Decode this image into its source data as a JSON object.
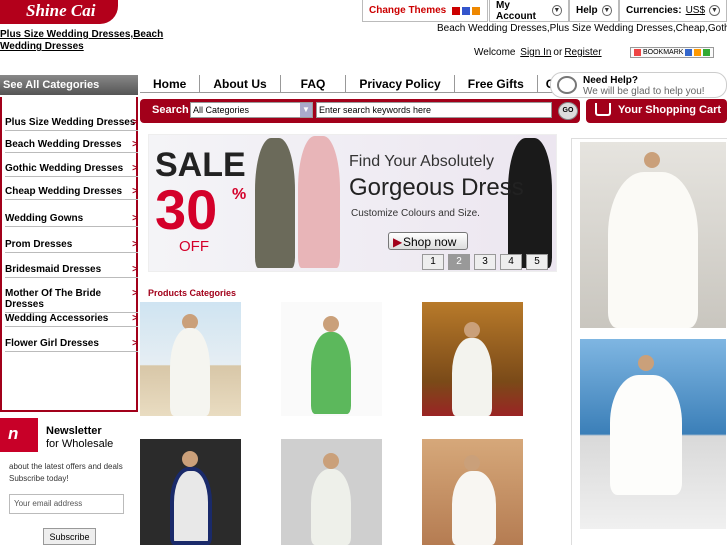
{
  "header": {
    "logo_text": "Shine Cai",
    "logo_subtitle": "Plus Size Wedding Dresses,Beach Wedding Dresses",
    "change_themes": "Change Themes",
    "theme_colors": [
      "#cc0000",
      "#3355cc",
      "#ee8800"
    ],
    "my_account": "My Account",
    "help": "Help",
    "currencies_label": "Currencies:",
    "currency_value": "US$",
    "keywords": "Beach Wedding Dresses,Plus Size Wedding Dresses,Cheap,Gothic",
    "welcome": "Welcome",
    "sign_in": "Sign In",
    "or": "or",
    "register": "Register",
    "bookmark": "BOOKMARK"
  },
  "nav": {
    "see_all": "See All Categories",
    "items": [
      "Home",
      "About Us",
      "FAQ",
      "Privacy Policy",
      "Free Gifts",
      "Contact Us"
    ],
    "need_help": "Need Help?",
    "help_sub": "We will be glad to help you!"
  },
  "search": {
    "label": "Search",
    "category": "All Categories",
    "placeholder": "Enter search keywords here",
    "go": "GO",
    "cart": "Your Shopping Cart"
  },
  "categories": [
    "Plus Size Wedding Dresses",
    "Beach Wedding Dresses",
    "Gothic Wedding Dresses",
    "Cheap Wedding Dresses",
    "Wedding Gowns",
    "Prom Dresses",
    "Bridesmaid Dresses",
    "Mother Of The Bride Dresses",
    "Wedding Accessories",
    "Flower Girl Dresses"
  ],
  "newsletter": {
    "icon_letter": "n",
    "title": "Newsletter",
    "subtitle": "for Wholesale",
    "desc": "about the latest offers and deals Subscribe today!",
    "placeholder": "Your email address",
    "button": "Subscribe"
  },
  "banner": {
    "sale": "SALE",
    "percent": "30",
    "pct_sign": "%",
    "off": "OFF",
    "find": "Find Your Absolutely",
    "gorgeous": "Gorgeous Dress",
    "customize": "Customize Colours and Size.",
    "shop_now": "Shop now",
    "pages": [
      "1",
      "2",
      "3",
      "4",
      "5"
    ],
    "active_page": "2"
  },
  "products": {
    "title": "Products Categories"
  }
}
